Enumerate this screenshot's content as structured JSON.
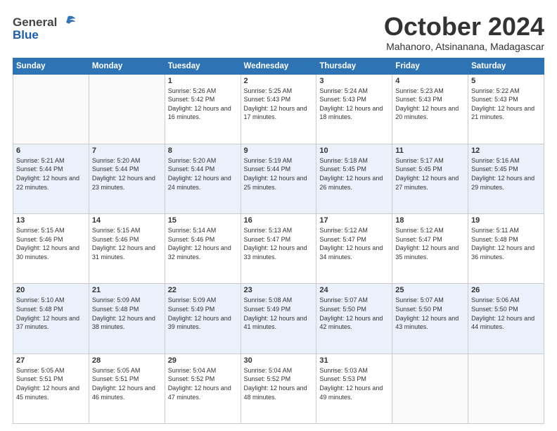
{
  "header": {
    "logo_general": "General",
    "logo_blue": "Blue",
    "month": "October 2024",
    "location": "Mahanoro, Atsinanana, Madagascar"
  },
  "weekdays": [
    "Sunday",
    "Monday",
    "Tuesday",
    "Wednesday",
    "Thursday",
    "Friday",
    "Saturday"
  ],
  "weeks": [
    [
      {
        "day": "",
        "info": ""
      },
      {
        "day": "",
        "info": ""
      },
      {
        "day": "1",
        "info": "Sunrise: 5:26 AM\nSunset: 5:42 PM\nDaylight: 12 hours and 16 minutes."
      },
      {
        "day": "2",
        "info": "Sunrise: 5:25 AM\nSunset: 5:43 PM\nDaylight: 12 hours and 17 minutes."
      },
      {
        "day": "3",
        "info": "Sunrise: 5:24 AM\nSunset: 5:43 PM\nDaylight: 12 hours and 18 minutes."
      },
      {
        "day": "4",
        "info": "Sunrise: 5:23 AM\nSunset: 5:43 PM\nDaylight: 12 hours and 20 minutes."
      },
      {
        "day": "5",
        "info": "Sunrise: 5:22 AM\nSunset: 5:43 PM\nDaylight: 12 hours and 21 minutes."
      }
    ],
    [
      {
        "day": "6",
        "info": "Sunrise: 5:21 AM\nSunset: 5:44 PM\nDaylight: 12 hours and 22 minutes."
      },
      {
        "day": "7",
        "info": "Sunrise: 5:20 AM\nSunset: 5:44 PM\nDaylight: 12 hours and 23 minutes."
      },
      {
        "day": "8",
        "info": "Sunrise: 5:20 AM\nSunset: 5:44 PM\nDaylight: 12 hours and 24 minutes."
      },
      {
        "day": "9",
        "info": "Sunrise: 5:19 AM\nSunset: 5:44 PM\nDaylight: 12 hours and 25 minutes."
      },
      {
        "day": "10",
        "info": "Sunrise: 5:18 AM\nSunset: 5:45 PM\nDaylight: 12 hours and 26 minutes."
      },
      {
        "day": "11",
        "info": "Sunrise: 5:17 AM\nSunset: 5:45 PM\nDaylight: 12 hours and 27 minutes."
      },
      {
        "day": "12",
        "info": "Sunrise: 5:16 AM\nSunset: 5:45 PM\nDaylight: 12 hours and 29 minutes."
      }
    ],
    [
      {
        "day": "13",
        "info": "Sunrise: 5:15 AM\nSunset: 5:46 PM\nDaylight: 12 hours and 30 minutes."
      },
      {
        "day": "14",
        "info": "Sunrise: 5:15 AM\nSunset: 5:46 PM\nDaylight: 12 hours and 31 minutes."
      },
      {
        "day": "15",
        "info": "Sunrise: 5:14 AM\nSunset: 5:46 PM\nDaylight: 12 hours and 32 minutes."
      },
      {
        "day": "16",
        "info": "Sunrise: 5:13 AM\nSunset: 5:47 PM\nDaylight: 12 hours and 33 minutes."
      },
      {
        "day": "17",
        "info": "Sunrise: 5:12 AM\nSunset: 5:47 PM\nDaylight: 12 hours and 34 minutes."
      },
      {
        "day": "18",
        "info": "Sunrise: 5:12 AM\nSunset: 5:47 PM\nDaylight: 12 hours and 35 minutes."
      },
      {
        "day": "19",
        "info": "Sunrise: 5:11 AM\nSunset: 5:48 PM\nDaylight: 12 hours and 36 minutes."
      }
    ],
    [
      {
        "day": "20",
        "info": "Sunrise: 5:10 AM\nSunset: 5:48 PM\nDaylight: 12 hours and 37 minutes."
      },
      {
        "day": "21",
        "info": "Sunrise: 5:09 AM\nSunset: 5:48 PM\nDaylight: 12 hours and 38 minutes."
      },
      {
        "day": "22",
        "info": "Sunrise: 5:09 AM\nSunset: 5:49 PM\nDaylight: 12 hours and 39 minutes."
      },
      {
        "day": "23",
        "info": "Sunrise: 5:08 AM\nSunset: 5:49 PM\nDaylight: 12 hours and 41 minutes."
      },
      {
        "day": "24",
        "info": "Sunrise: 5:07 AM\nSunset: 5:50 PM\nDaylight: 12 hours and 42 minutes."
      },
      {
        "day": "25",
        "info": "Sunrise: 5:07 AM\nSunset: 5:50 PM\nDaylight: 12 hours and 43 minutes."
      },
      {
        "day": "26",
        "info": "Sunrise: 5:06 AM\nSunset: 5:50 PM\nDaylight: 12 hours and 44 minutes."
      }
    ],
    [
      {
        "day": "27",
        "info": "Sunrise: 5:05 AM\nSunset: 5:51 PM\nDaylight: 12 hours and 45 minutes."
      },
      {
        "day": "28",
        "info": "Sunrise: 5:05 AM\nSunset: 5:51 PM\nDaylight: 12 hours and 46 minutes."
      },
      {
        "day": "29",
        "info": "Sunrise: 5:04 AM\nSunset: 5:52 PM\nDaylight: 12 hours and 47 minutes."
      },
      {
        "day": "30",
        "info": "Sunrise: 5:04 AM\nSunset: 5:52 PM\nDaylight: 12 hours and 48 minutes."
      },
      {
        "day": "31",
        "info": "Sunrise: 5:03 AM\nSunset: 5:53 PM\nDaylight: 12 hours and 49 minutes."
      },
      {
        "day": "",
        "info": ""
      },
      {
        "day": "",
        "info": ""
      }
    ]
  ]
}
